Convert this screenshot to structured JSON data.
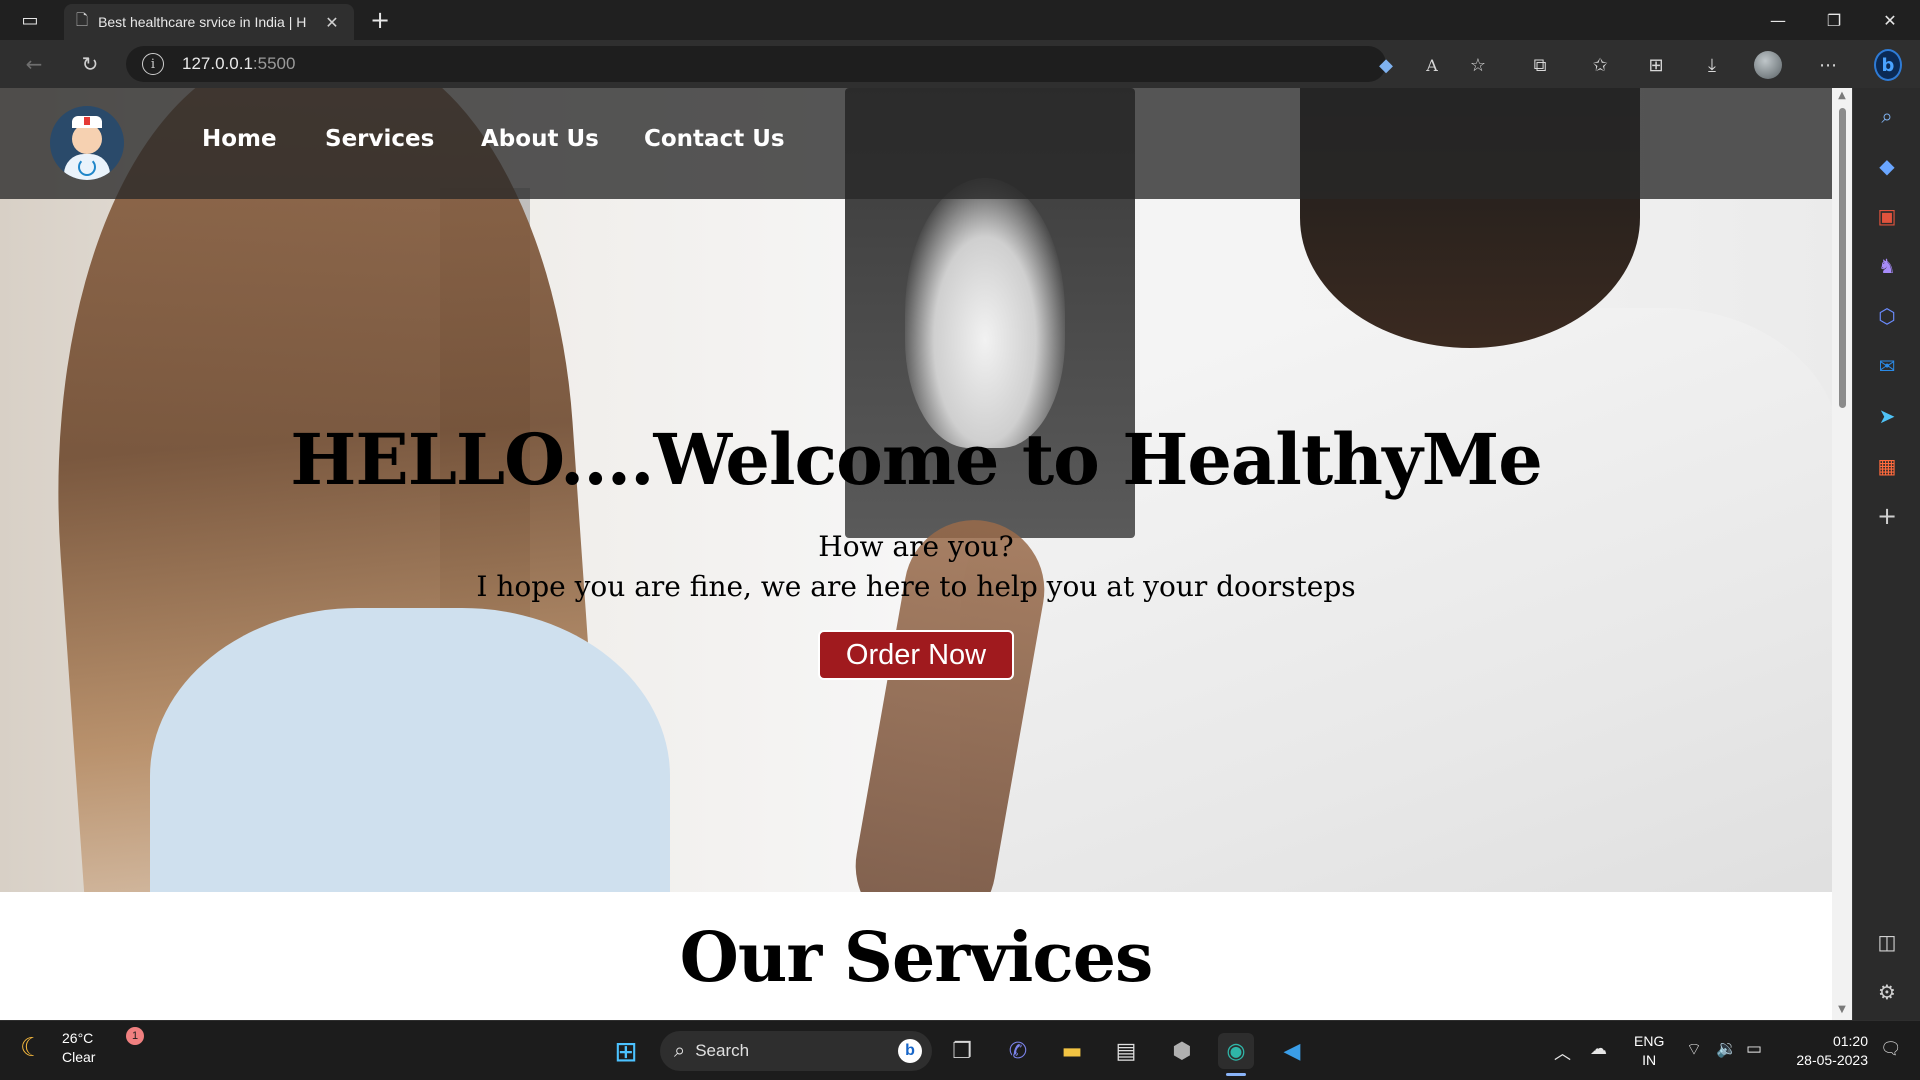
{
  "browser": {
    "tab_title": "Best healthcare srvice in India | H",
    "url_host": "127.0.0.1",
    "url_port": ":5500"
  },
  "site": {
    "nav": [
      "Home",
      "Services",
      "About Us",
      "Contact Us"
    ],
    "hero_title": "HELLO....Welcome to HealthyMe",
    "hero_sub1": "How are you?",
    "hero_sub2": "I hope you are fine, we are here to help you at your doorsteps",
    "order_button": "Order Now",
    "services_heading": "Our Services"
  },
  "taskbar": {
    "temperature": "26°C",
    "weather": "Clear",
    "weather_badge": "1",
    "search_placeholder": "Search",
    "lang_line1": "ENG",
    "lang_line2": "IN",
    "time": "01:20",
    "date": "28-05-2023"
  },
  "colors": {
    "order_button_bg": "#a01a1e",
    "nav_overlay": "rgba(40,40,40,0.78)",
    "browser_chrome": "#202020"
  }
}
